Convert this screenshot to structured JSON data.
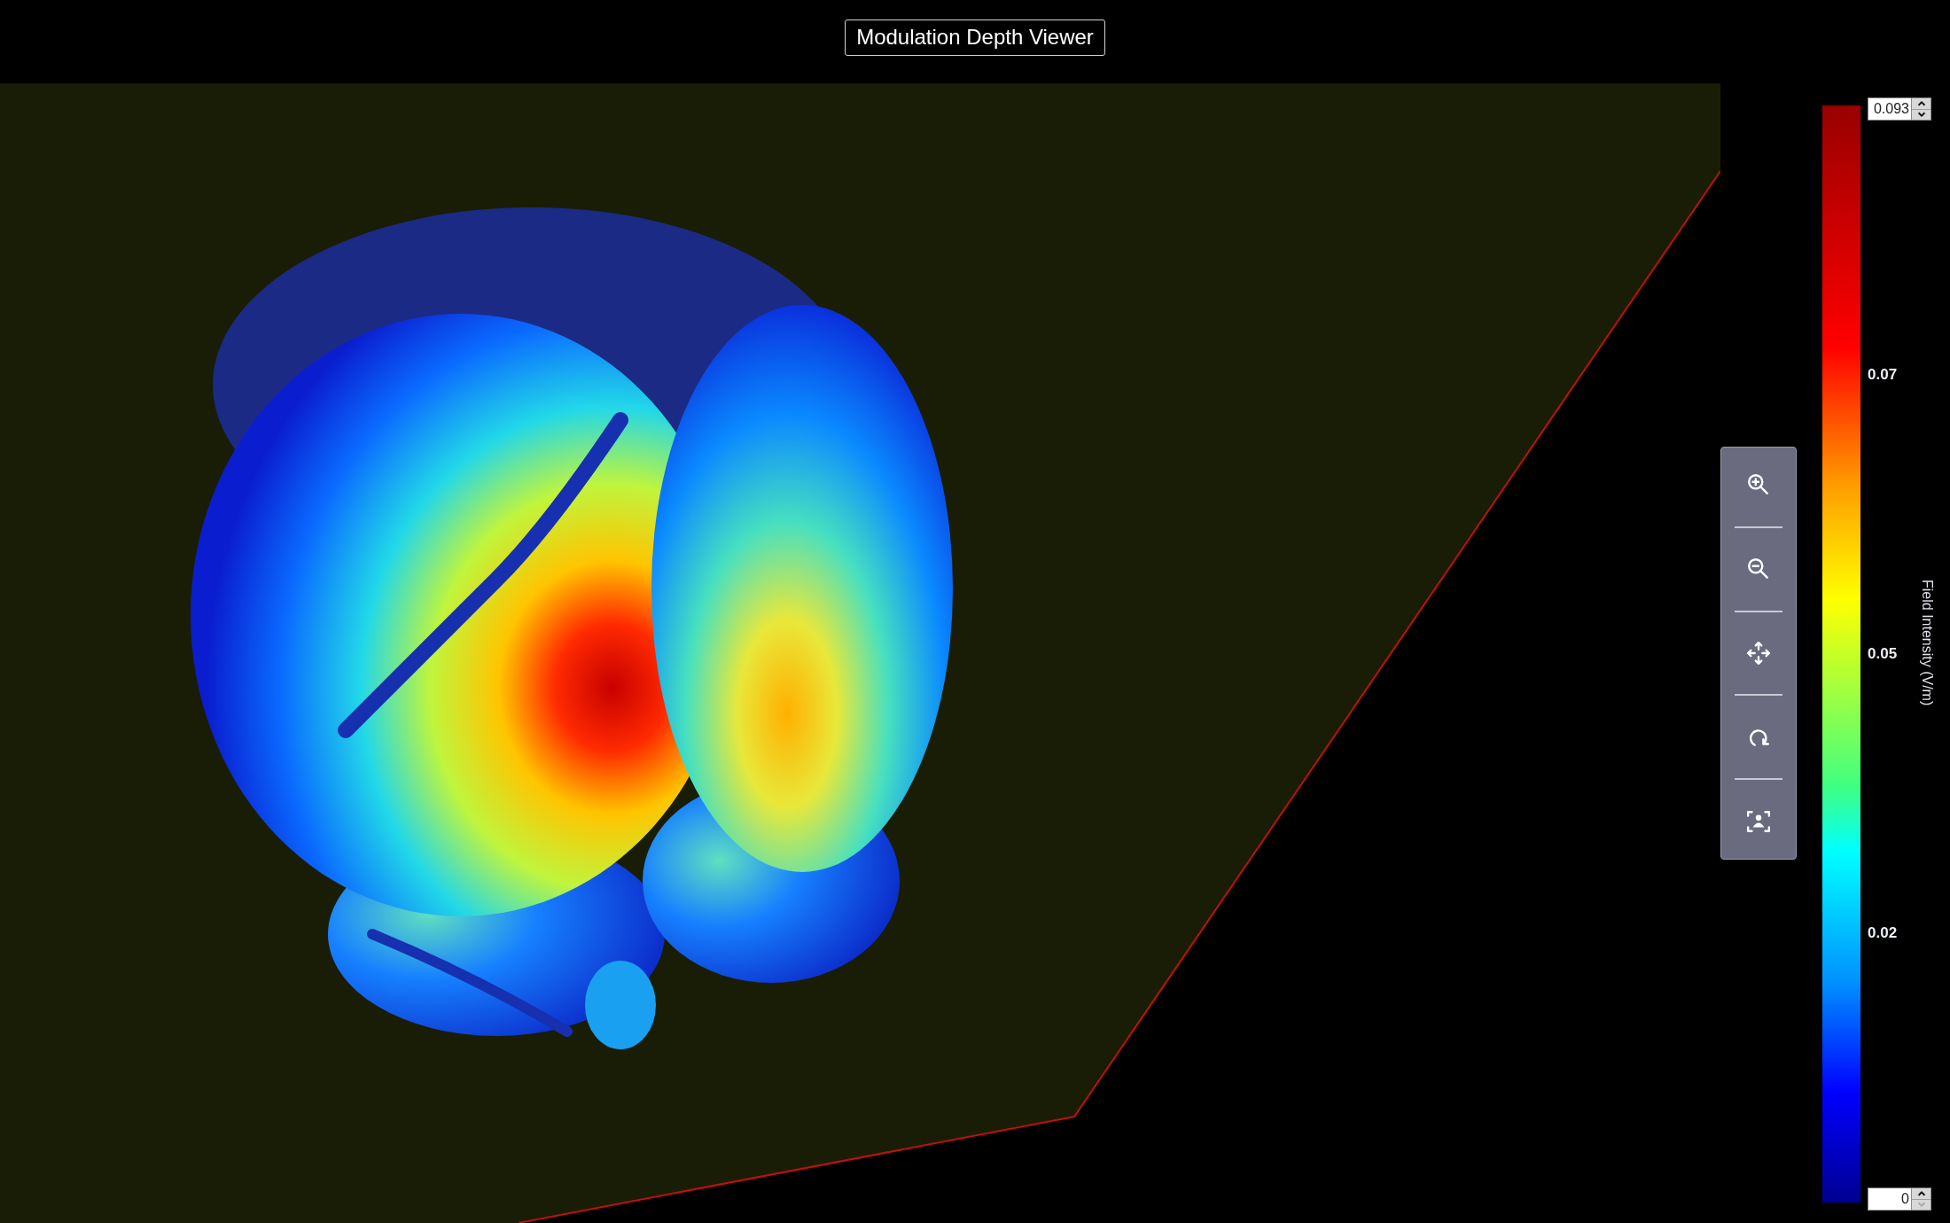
{
  "header": {
    "title": "Modulation Depth Viewer"
  },
  "toolbar": {
    "tools": [
      {
        "kind": "zoom_in"
      },
      {
        "kind": "zoom_out"
      },
      {
        "kind": "pan"
      },
      {
        "kind": "rotate"
      },
      {
        "kind": "fit"
      }
    ]
  },
  "colorbar": {
    "max_field": {
      "value": "0.093",
      "up_enabled": true,
      "down_enabled": true
    },
    "ticks": [
      "0.07",
      "0.05",
      "0.02"
    ],
    "min_field": {
      "value": "0",
      "up_enabled": true,
      "down_enabled": false
    },
    "label": "Field Intensity (V/m)"
  }
}
